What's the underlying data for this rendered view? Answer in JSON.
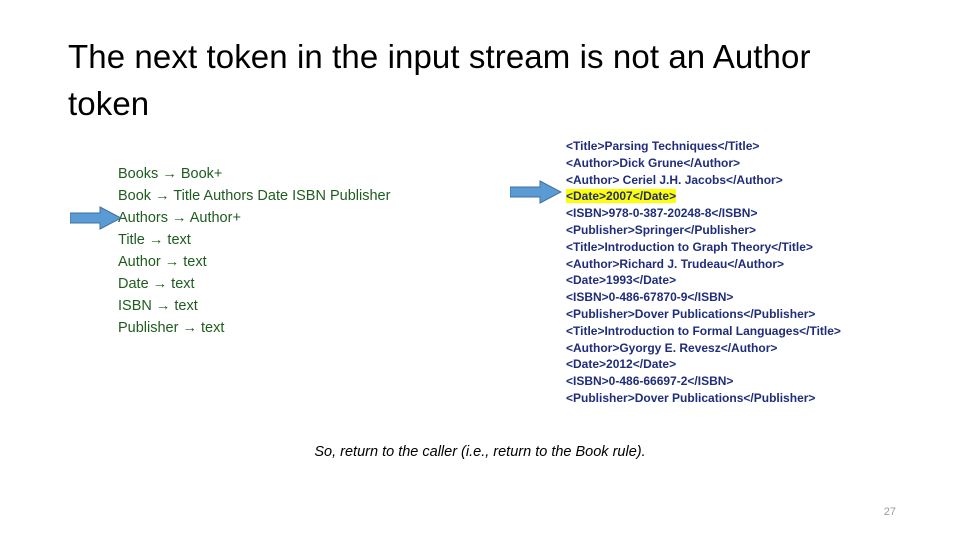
{
  "slide": {
    "title": "The next token in the input stream is not an Author token",
    "caption": "So, return to the caller (i.e., return to the Book rule).",
    "page_number": "27"
  },
  "colors": {
    "grammar_text": "#1F5C1F",
    "xml_text": "#1F2D7A",
    "highlight": "#FFFF00",
    "arrow_fill": "#5B9BD5",
    "arrow_stroke": "#41719C",
    "title_text": "#000000",
    "page_number": "#9A9A9A",
    "background": "#FFFFFF"
  },
  "grammar": {
    "rules": [
      {
        "text": "Books → Book+",
        "marked": false
      },
      {
        "text": "Book → Title Authors Date ISBN Publisher",
        "marked": false
      },
      {
        "text": "Authors → Author+",
        "marked": true
      },
      {
        "text": "Title → text",
        "marked": false
      },
      {
        "text": "Author → text",
        "marked": false
      },
      {
        "text": "Date → text",
        "marked": false
      },
      {
        "text": "ISBN → text",
        "marked": false
      },
      {
        "text": "Publisher → text",
        "marked": false
      }
    ]
  },
  "xml": {
    "lines": [
      {
        "text": "<Title>Parsing Techniques</Title>",
        "highlighted": false,
        "marked": false
      },
      {
        "text": "<Author>Dick Grune</Author>",
        "highlighted": false,
        "marked": false
      },
      {
        "text": "<Author> Ceriel J.H. Jacobs</Author>",
        "highlighted": false,
        "marked": false
      },
      {
        "text": "<Date>2007</Date>",
        "highlighted": true,
        "marked": true
      },
      {
        "text": "<ISBN>978-0-387-20248-8</ISBN>",
        "highlighted": false,
        "marked": false
      },
      {
        "text": "<Publisher>Springer</Publisher>",
        "highlighted": false,
        "marked": false
      },
      {
        "text": "<Title>Introduction to Graph Theory</Title>",
        "highlighted": false,
        "marked": false
      },
      {
        "text": "<Author>Richard J. Trudeau</Author>",
        "highlighted": false,
        "marked": false
      },
      {
        "text": "<Date>1993</Date>",
        "highlighted": false,
        "marked": false
      },
      {
        "text": "<ISBN>0-486-67870-9</ISBN>",
        "highlighted": false,
        "marked": false
      },
      {
        "text": "<Publisher>Dover Publications</Publisher>",
        "highlighted": false,
        "marked": false
      },
      {
        "text": "<Title>Introduction to Formal Languages</Title>",
        "highlighted": false,
        "marked": false
      },
      {
        "text": "<Author>Gyorgy E. Revesz</Author>",
        "highlighted": false,
        "marked": false
      },
      {
        "text": "<Date>2012</Date>",
        "highlighted": false,
        "marked": false
      },
      {
        "text": "<ISBN>0-486-66697-2</ISBN>",
        "highlighted": false,
        "marked": false
      },
      {
        "text": "<Publisher>Dover Publications</Publisher>",
        "highlighted": false,
        "marked": false
      }
    ]
  },
  "arrows": {
    "left": {
      "name": "pointer-arrow-grammar",
      "points_to": "Authors → Author+"
    },
    "right": {
      "name": "pointer-arrow-xml",
      "points_to": "<Date>2007</Date>"
    }
  }
}
